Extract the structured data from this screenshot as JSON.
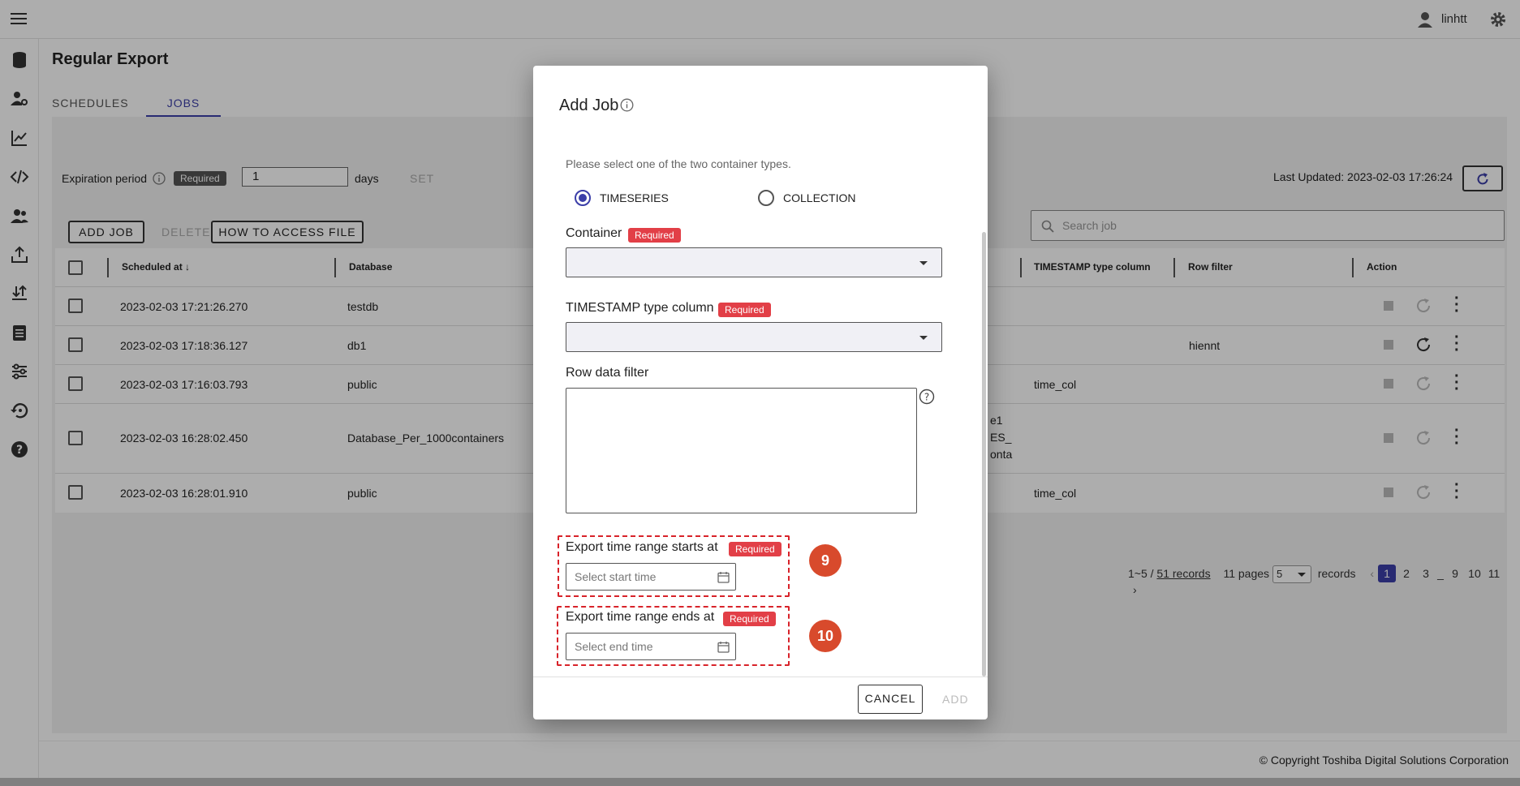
{
  "topbar": {
    "username": "linhtt"
  },
  "page": {
    "title": "Regular Export",
    "tabs": [
      {
        "label": "SCHEDULES"
      },
      {
        "label": "JOBS"
      }
    ]
  },
  "toolbar": {
    "expiration_label": "Expiration period",
    "required": "Required",
    "expiration_value": "1",
    "days": "days",
    "set": "SET",
    "last_updated": "Last Updated: 2023-02-03 17:26:24",
    "add_job": "ADD JOB",
    "delete": "DELETE",
    "how_to_access": "HOW TO ACCESS FILE",
    "search_placeholder": "Search job"
  },
  "pagination": {
    "range": "1~5 / ",
    "records_link": "51 records",
    "pages": "11 pages",
    "page_size": "5",
    "records": "records",
    "pages_list": [
      "1",
      "2",
      "3",
      "_",
      "9",
      "10",
      "11"
    ]
  },
  "table": {
    "headers": [
      "Scheduled at",
      "Database",
      "TIMESTAMP type column",
      "Row filter",
      "Action"
    ],
    "rows": [
      {
        "scheduled": "2023-02-03 17:21:26.270",
        "database": "testdb",
        "ts_col": "",
        "filter": "",
        "extra": ""
      },
      {
        "scheduled": "2023-02-03 17:18:36.127",
        "database": "db1",
        "ts_col": "",
        "filter": "hiennt",
        "extra": ""
      },
      {
        "scheduled": "2023-02-03 17:16:03.793",
        "database": "public",
        "ts_col": "time_col",
        "filter": "",
        "extra": ""
      },
      {
        "scheduled": "2023-02-03 16:28:02.450",
        "database": "Database_Per_1000containers",
        "ts_col": "",
        "filter": "",
        "extra": "e1\nES_\nonta"
      },
      {
        "scheduled": "2023-02-03 16:28:01.910",
        "database": "public",
        "ts_col": "time_col",
        "filter": "",
        "extra": ""
      }
    ]
  },
  "footer": {
    "copyright": "© Copyright Toshiba Digital Solutions Corporation"
  },
  "modal": {
    "title": "Add Job",
    "instruction": "Please select one of the two container types.",
    "radio_timeseries": "TIMESERIES",
    "radio_collection": "COLLECTION",
    "container_label": "Container",
    "required": "Required",
    "ts_col_label": "TIMESTAMP type column",
    "row_filter_label": "Row data filter",
    "start_label": "Export time range starts at",
    "start_placeholder": "Select start time",
    "end_label": "Export time range ends at",
    "end_placeholder": "Select end time",
    "step_start": "9",
    "step_end": "10",
    "cancel": "CANCEL",
    "add": "ADD"
  }
}
